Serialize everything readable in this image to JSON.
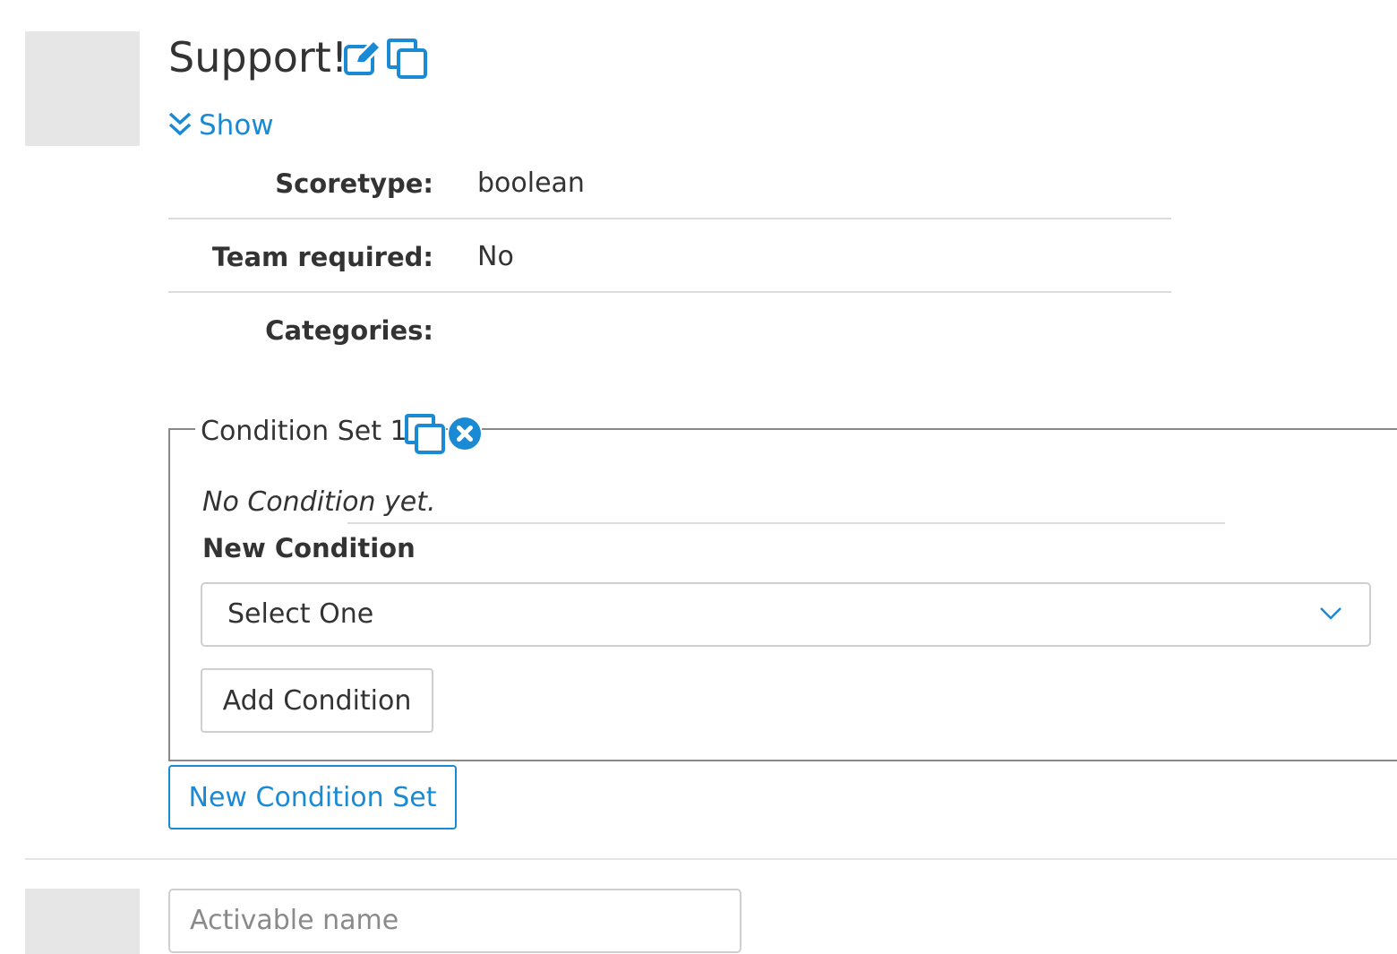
{
  "activable": {
    "title": "Support!",
    "toggle_label": "Show",
    "properties": [
      {
        "label": "Scoretype:",
        "value": "boolean"
      },
      {
        "label": "Team required:",
        "value": "No"
      },
      {
        "label": "Categories:",
        "value": ""
      }
    ],
    "condition_sets": [
      {
        "legend": "Condition Set 1",
        "empty_text": "No Condition yet.",
        "new_condition_label": "New Condition",
        "select_value": "Select One",
        "add_button": "Add Condition"
      }
    ],
    "new_condition_set_button": "New Condition Set"
  },
  "new_activable": {
    "name_placeholder": "Activable name"
  },
  "colors": {
    "accent": "#1a8ad4",
    "thumbnail": "#e6e6e6",
    "text": "#333333"
  },
  "icons": [
    "edit-icon",
    "copy-icon",
    "chevron-double-down-icon",
    "close-circle-icon",
    "chevron-down-icon"
  ]
}
